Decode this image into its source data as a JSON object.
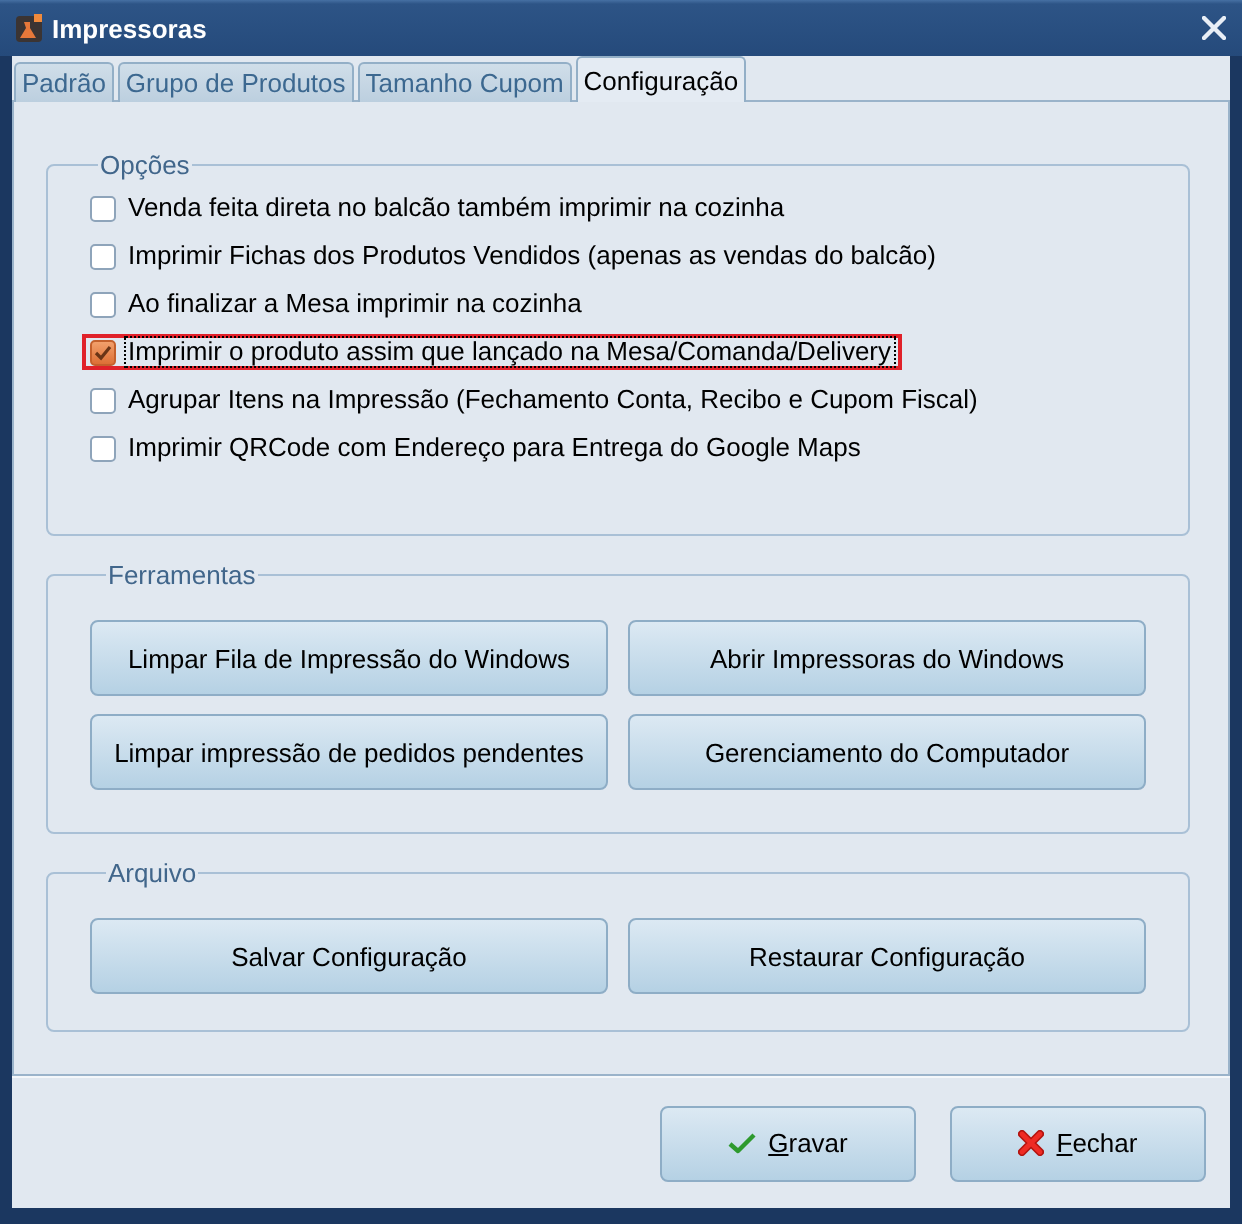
{
  "window": {
    "title": "Impressoras"
  },
  "tabs": [
    {
      "label": "Padrão",
      "selected": false
    },
    {
      "label": "Grupo de Produtos",
      "selected": false
    },
    {
      "label": "Tamanho Cupom",
      "selected": false
    },
    {
      "label": "Configuração",
      "selected": true
    }
  ],
  "groups": [
    {
      "kind": "checklist",
      "title": "Opções",
      "options": [
        {
          "label": "Venda feita direta no balcão também imprimir na cozinha",
          "checked": false,
          "highlighted": false,
          "focused": false
        },
        {
          "label": "Imprimir Fichas dos Produtos Vendidos (apenas as vendas do balcão)",
          "checked": false,
          "highlighted": false,
          "focused": false
        },
        {
          "label": "Ao finalizar a Mesa imprimir na cozinha",
          "checked": false,
          "highlighted": false,
          "focused": false
        },
        {
          "label": "Imprimir o produto assim que lançado na Mesa/Comanda/Delivery",
          "checked": true,
          "highlighted": true,
          "focused": true
        },
        {
          "label": "Agrupar Itens na Impressão (Fechamento Conta, Recibo e Cupom Fiscal)",
          "checked": false,
          "highlighted": false,
          "focused": false
        },
        {
          "label": "Imprimir QRCode com Endereço para Entrega do Google Maps",
          "checked": false,
          "highlighted": false,
          "focused": false
        }
      ]
    },
    {
      "kind": "buttons",
      "title": "Ferramentas",
      "buttons": [
        "Limpar Fila de Impressão do Windows",
        "Abrir Impressoras do Windows",
        "Limpar impressão de pedidos pendentes",
        "Gerenciamento do Computador"
      ]
    },
    {
      "kind": "buttons",
      "title": "Arquivo",
      "buttons": [
        "Salvar Configuração",
        "Restaurar Configuração"
      ]
    }
  ],
  "footer_buttons": [
    {
      "label": "Gravar",
      "kind": "confirm",
      "mnemonic_underlined": true
    },
    {
      "label": "Fechar",
      "kind": "close",
      "mnemonic_underlined": true
    }
  ]
}
